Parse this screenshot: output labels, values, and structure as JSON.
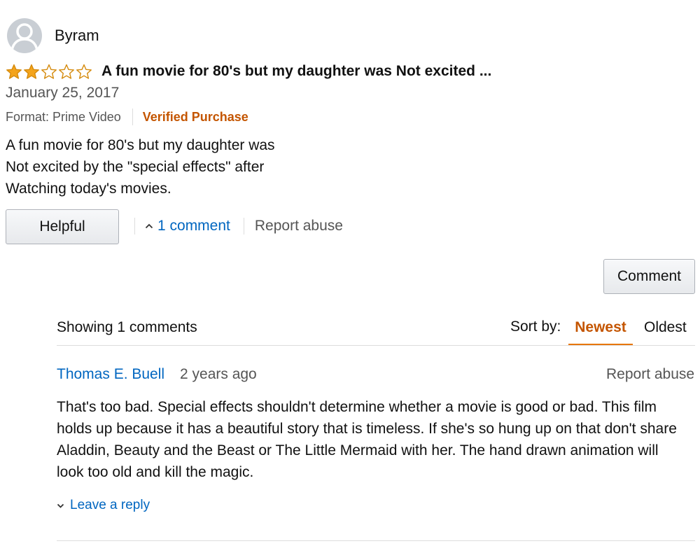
{
  "review": {
    "reviewer_name": "Byram",
    "rating": 2,
    "rating_max": 5,
    "title": "A fun movie for 80's but my daughter was Not excited ...",
    "date": "January 25, 2017",
    "format": "Format: Prime Video",
    "verified": "Verified Purchase",
    "body_lines": [
      "A fun movie for 80's but my daughter was",
      "Not excited by the \"special effects\" after",
      "Watching today's movies."
    ],
    "helpful_label": "Helpful",
    "comments_link": "1 comment",
    "report_label": "Report abuse"
  },
  "comments_section": {
    "comment_button_label": "Comment",
    "showing_label": "Showing 1 comments",
    "sort_label": "Sort by:",
    "sort_newest": "Newest",
    "sort_oldest": "Oldest",
    "sort_selected": "Newest"
  },
  "comment": {
    "author": "Thomas E. Buell",
    "time_ago": "2 years ago",
    "report_label": "Report abuse",
    "text_lines": [
      "That's too bad. Special effects shouldn't determine whether a movie is good or bad. This film",
      "holds up because it has a beautiful story that is timeless. If she's so hung up on that don't share",
      "Aladdin, Beauty and the Beast or The Little Mermaid with her. The hand drawn animation will",
      "look too old and kill the magic."
    ],
    "reply_label": "Leave a reply"
  },
  "colors": {
    "star_fill": "#f4a41c",
    "star_stroke": "#d58b0e",
    "link": "#0066c0",
    "accent": "#c45500"
  },
  "icons": {
    "avatar": "person-silhouette-icon",
    "expand": "chevron-up-icon",
    "reply": "chevron-down-icon"
  }
}
